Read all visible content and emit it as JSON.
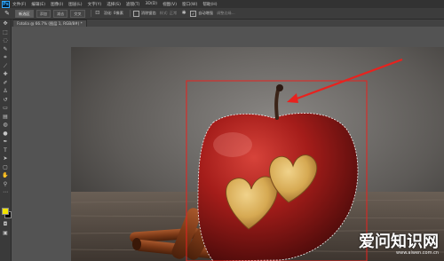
{
  "app": {
    "logo": "Ps"
  },
  "menu": [
    "文件(F)",
    "编辑(E)",
    "图像(I)",
    "图层(L)",
    "文字(Y)",
    "选择(S)",
    "滤镜(T)",
    "3D(D)",
    "视图(V)",
    "窗口(W)",
    "帮助(H)"
  ],
  "options": {
    "tool_icon": "lasso-icon",
    "mode_buttons": [
      "新选区",
      "添加",
      "减去",
      "交叉"
    ],
    "feather_label": "羽化: 0像素",
    "antialias": "消除锯齿",
    "style_label": "样式: 正常",
    "refine_edge": "调整边缘...",
    "auto_enhance": "自动增强",
    "auto_label": "自动选择图层"
  },
  "document": {
    "tab_title": "Fotolia @ 66.7% (图层 1, RGB/8#) *"
  },
  "canvas": {
    "annotation_color": "#e8221e",
    "selection_color": "#e8221e"
  },
  "watermark": {
    "text": "爱问知识网",
    "url": "www.aiwen.com.cn"
  }
}
